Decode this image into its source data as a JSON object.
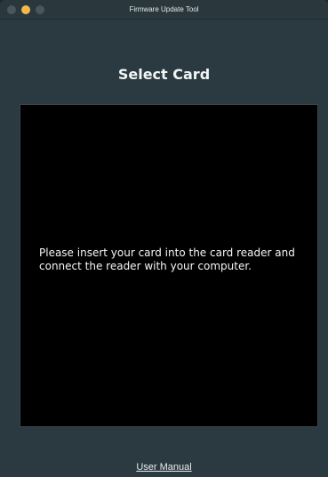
{
  "window": {
    "title": "Firmware Update Tool"
  },
  "main": {
    "heading": "Select Card",
    "instructions": "Please insert your card into the card reader and connect the reader with your computer.",
    "manual_link": "User Manual"
  },
  "colors": {
    "background": "#2b3a40",
    "panel": "#000000",
    "text": "#f4f6f7",
    "minimize_button": "#f5b94a"
  }
}
